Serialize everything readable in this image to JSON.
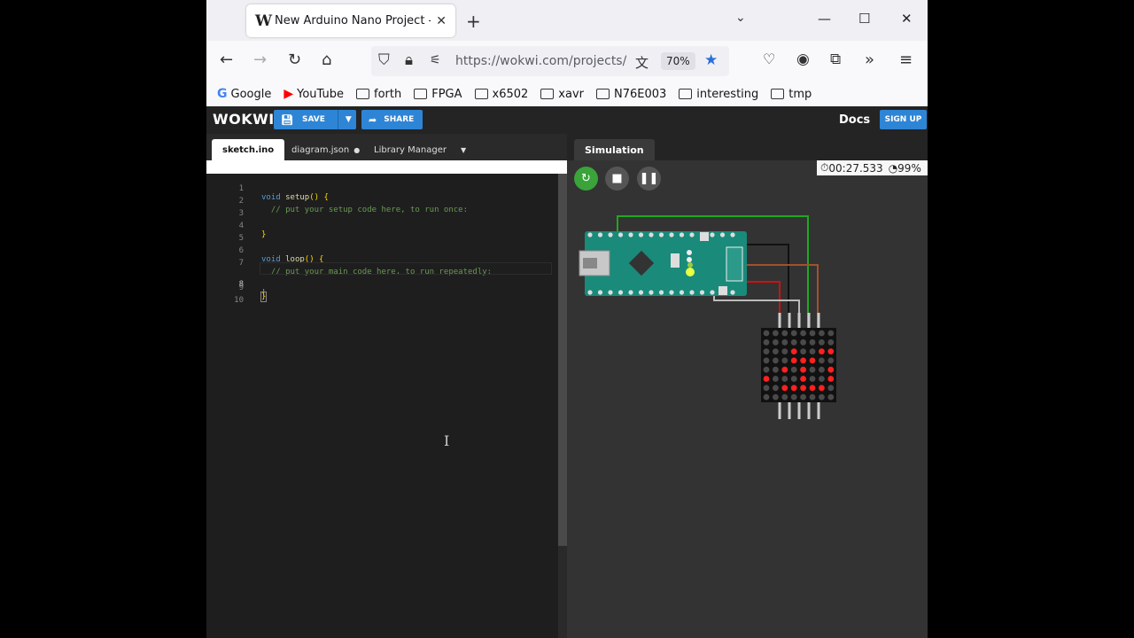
{
  "browser": {
    "tab_title": "New Arduino Nano Project - Wokwi",
    "tab_favicon": "W",
    "url": "https://wokwi.com/projects/new/arduino-nano",
    "zoom": "70%"
  },
  "bookmarks": [
    {
      "label": "Google",
      "icon": "google-icon"
    },
    {
      "label": "YouTube",
      "icon": "youtube-icon"
    },
    {
      "label": "forth",
      "icon": "folder-icon"
    },
    {
      "label": "FPGA",
      "icon": "folder-icon"
    },
    {
      "label": "x6502",
      "icon": "folder-icon"
    },
    {
      "label": "xavr",
      "icon": "folder-icon"
    },
    {
      "label": "N76E003",
      "icon": "folder-icon"
    },
    {
      "label": "interesting",
      "icon": "folder-icon"
    },
    {
      "label": "tmp",
      "icon": "folder-icon"
    }
  ],
  "wokwi": {
    "logo": "WOKWI",
    "save_label": "SAVE",
    "share_label": "SHARE",
    "docs_label": "Docs",
    "signup_label": "SIGN UP"
  },
  "editor": {
    "tabs": [
      "sketch.ino",
      "diagram.json",
      "Library Manager"
    ],
    "modified_marker": "●",
    "line_numbers": [
      "1",
      "2",
      "3",
      "4",
      "5",
      "6",
      "7",
      "8",
      "9",
      "10"
    ],
    "lines": {
      "l1_kw": "void",
      "l1_fn": "setup",
      "l1_rest": "() {",
      "l2": "  // put your setup code here, to run once:",
      "l4": "}",
      "l6_kw": "void",
      "l6_fn": "loop",
      "l6_rest": "() {",
      "l7": "  // put your main code here, to run repeatedly:",
      "l9": "}"
    }
  },
  "simulation": {
    "tab_label": "Simulation",
    "elapsed": "00:27.533",
    "speed": "99%",
    "matrix_pattern": [
      [
        0,
        0,
        0,
        0,
        0,
        0,
        0,
        0
      ],
      [
        0,
        0,
        0,
        0,
        0,
        0,
        0,
        0
      ],
      [
        0,
        0,
        0,
        1,
        0,
        0,
        1,
        1
      ],
      [
        0,
        0,
        0,
        1,
        1,
        1,
        0,
        0
      ],
      [
        0,
        0,
        1,
        0,
        1,
        0,
        0,
        1
      ],
      [
        1,
        0,
        0,
        0,
        1,
        0,
        0,
        1
      ],
      [
        0,
        0,
        1,
        1,
        1,
        1,
        1,
        0
      ],
      [
        0,
        0,
        0,
        0,
        0,
        0,
        0,
        0
      ]
    ],
    "colors": {
      "board": "#1a8a7a",
      "led_on": "#ff2020",
      "led_off": "#4a4a4a",
      "wire_green": "#1fa81f",
      "wire_black": "#111111",
      "wire_brown": "#a0522d",
      "wire_red": "#d01010",
      "wire_gray": "#bbbbbb"
    }
  }
}
